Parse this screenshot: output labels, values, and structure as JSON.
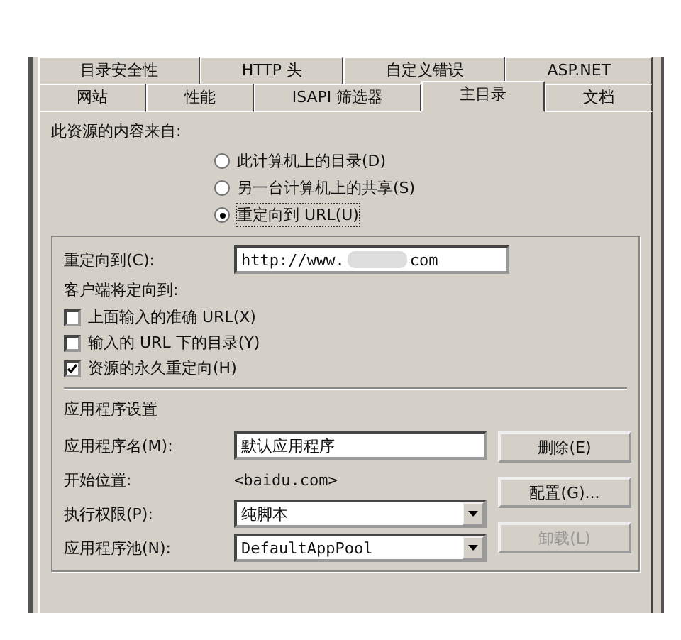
{
  "tabs_back": [
    {
      "label": "目录安全性",
      "selected": false
    },
    {
      "label": "HTTP 头",
      "selected": false
    },
    {
      "label": "自定义错误",
      "selected": false
    },
    {
      "label": "ASP.NET",
      "selected": false
    }
  ],
  "tabs_front": [
    {
      "label": "网站",
      "selected": false
    },
    {
      "label": "性能",
      "selected": false
    },
    {
      "label": "ISAPI 筛选器",
      "selected": false
    },
    {
      "label": "主目录",
      "selected": true
    },
    {
      "label": "文档",
      "selected": false
    }
  ],
  "source": {
    "label": "此资源的内容来自:",
    "options": [
      {
        "label": "此计算机上的目录(D)",
        "selected": false
      },
      {
        "label": "另一台计算机上的共享(S)",
        "selected": false
      },
      {
        "label": "重定向到 URL(U)",
        "selected": true
      }
    ]
  },
  "redirect": {
    "label": "重定向到(C):",
    "value": "http://www.",
    "value_end": "com",
    "client_label": "客户端将定向到:",
    "options": [
      {
        "label": "上面输入的准确 URL(X)",
        "checked": false
      },
      {
        "label": "输入的 URL 下的目录(Y)",
        "checked": false
      },
      {
        "label": "资源的永久重定向(H)",
        "checked": true
      }
    ]
  },
  "app": {
    "title": "应用程序设置",
    "rows": [
      {
        "kind": "input",
        "label": "应用程序名(M):",
        "value": "默认应用程序"
      },
      {
        "kind": "text",
        "label": "开始位置:",
        "value": "<baidu.com>"
      },
      {
        "kind": "select",
        "label": "执行权限(P):",
        "value": "纯脚本"
      },
      {
        "kind": "select",
        "label": "应用程序池(N):",
        "value": "DefaultAppPool"
      }
    ],
    "buttons": [
      {
        "label": "删除(E)",
        "disabled": false
      },
      {
        "label": "配置(G)...",
        "disabled": false
      },
      {
        "label": "卸载(L)",
        "disabled": true
      }
    ]
  }
}
